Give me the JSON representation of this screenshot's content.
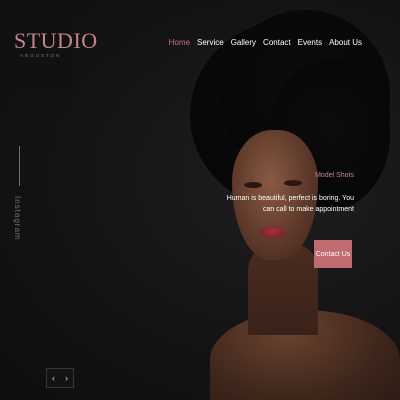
{
  "brand": {
    "title": "STUDIO",
    "subtitle": "ANGUSTON"
  },
  "nav": {
    "items": [
      {
        "label": "Home",
        "active": true
      },
      {
        "label": "Service",
        "active": false
      },
      {
        "label": "Gallery",
        "active": false
      },
      {
        "label": "Contact",
        "active": false
      },
      {
        "label": "Events",
        "active": false
      },
      {
        "label": "About Us",
        "active": false
      }
    ]
  },
  "social": {
    "label": "Instagram"
  },
  "hero": {
    "caption_title": "Model Shots",
    "caption_text": "Human is beautiful, perfect is boring. You can call to make appointment",
    "cta_label": "Contact Us"
  },
  "slider": {
    "prev_icon": "‹",
    "next_icon": "›"
  },
  "colors": {
    "accent": "#c06a72",
    "background": "#141315",
    "text": "#ffffff"
  }
}
